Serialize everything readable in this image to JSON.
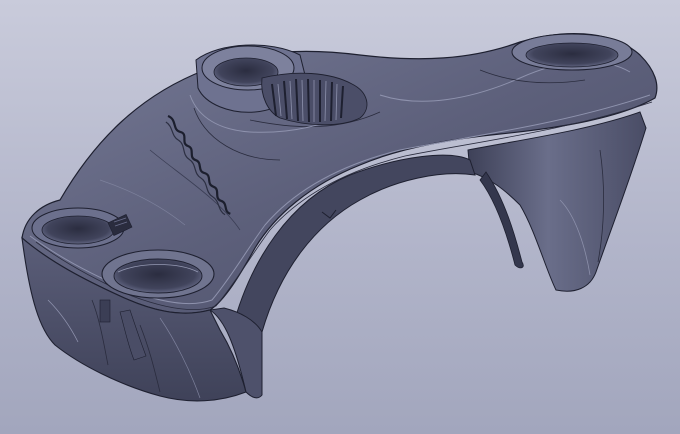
{
  "viewport": {
    "background_top": "#c9cbdb",
    "background_bottom": "#a2a6bd"
  },
  "model": {
    "kind": "motorcycle-triple-clamp-3d-render",
    "body_color": "#5a5d77",
    "shadow_color": "#3b3e55",
    "highlight_color": "#8e92ad",
    "edge_color": "#1e2030",
    "engraving_text": "",
    "engraving_legible": false
  }
}
